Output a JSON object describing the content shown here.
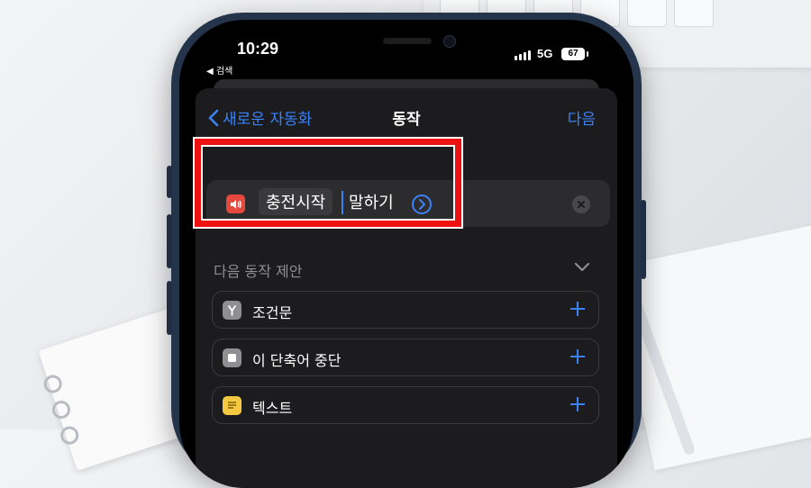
{
  "status_bar": {
    "time": "10:29",
    "back_app": "◀ 검색",
    "network": "5G",
    "battery": "67"
  },
  "nav": {
    "back_label": "새로운 자동화",
    "title": "동작",
    "next_label": "다음"
  },
  "action": {
    "icon": "speaker-icon",
    "parameter": "충전시작",
    "verb": "말하기"
  },
  "suggestions": {
    "heading": "다음 동작 제안",
    "items": [
      {
        "label": "조건문",
        "icon": "branch-icon",
        "color": "#8e8e93"
      },
      {
        "label": "이 단축어 중단",
        "icon": "stop-icon",
        "color": "#8e8e93"
      },
      {
        "label": "텍스트",
        "icon": "text-icon",
        "color": "#f5c842"
      }
    ]
  },
  "colors": {
    "accent": "#3b82f6",
    "highlight": "#ee1111",
    "speaker": "#e5483d"
  }
}
